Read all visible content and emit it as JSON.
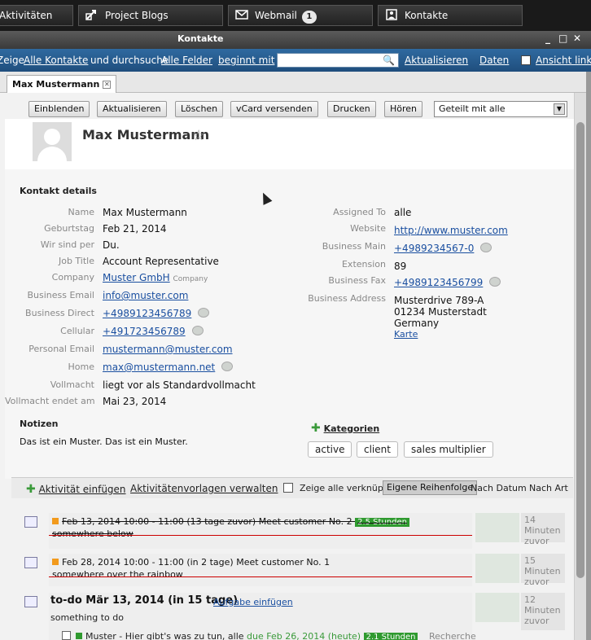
{
  "taskbar": {
    "tasks": [
      {
        "label": "Aktivitäten",
        "icon": "list-icon"
      },
      {
        "label": "Project Blogs",
        "icon": "blog-icon"
      },
      {
        "label": "Webmail",
        "icon": "mail-icon",
        "badge": "1"
      },
      {
        "label": "Kontakte",
        "icon": "contacts-icon"
      }
    ]
  },
  "window": {
    "title": "Kontakte",
    "minimize": "_",
    "maximize": "□",
    "close": "✕"
  },
  "search": {
    "prefix": "Zeige",
    "scope": "Alle Kontakte",
    "mid": "und durchsuche",
    "field": "Alle Felder",
    "mode": "beginnt mit",
    "value": "",
    "refresh": "Aktualisieren",
    "data": "Daten",
    "view": "Ansicht links"
  },
  "tab": {
    "label": "Max Mustermann"
  },
  "toolbar": {
    "buttons": [
      "Einblenden",
      "Aktualisieren",
      "Löschen",
      "vCard versenden",
      "Drucken",
      "Hören"
    ],
    "share": "Geteilt mit alle"
  },
  "contact": {
    "name": "Max Mustermann",
    "section_title": "Kontakt details",
    "left": [
      {
        "label": "Name",
        "value": "Max Mustermann"
      },
      {
        "label": "Geburtstag",
        "value": "Feb 21, 2014"
      },
      {
        "label": "Wir sind per",
        "value": "Du."
      },
      {
        "label": "Job Title",
        "value": "Account Representative"
      },
      {
        "label": "Company",
        "value": "Muster GmbH",
        "note": "Company"
      },
      {
        "label": "Business Email",
        "value": "info@muster.com"
      },
      {
        "label": "Business Direct",
        "value": "+4989123456789"
      },
      {
        "label": "Cellular",
        "value": "+491723456789"
      },
      {
        "label": "Personal Email",
        "value": "mustermann@muster.com"
      },
      {
        "label": "Home",
        "value": "max@mustermann.net"
      },
      {
        "label": "Vollmacht",
        "value": "liegt vor als Standardvollmacht"
      },
      {
        "label": "Vollmacht endet am",
        "value": "Mai 23, 2014"
      }
    ],
    "right": [
      {
        "label": "Assigned To",
        "value": "alle"
      },
      {
        "label": "Website",
        "value": "http://www.muster.com"
      },
      {
        "label": "Business Main",
        "value": "+4989234567-0"
      },
      {
        "label": "Extension",
        "value": "89"
      },
      {
        "label": "Business Fax",
        "value": "+4989123456799"
      },
      {
        "label": "Business Address",
        "line1": "Musterdrive 789-A",
        "line2": "01234 Musterstadt",
        "line3": "Germany",
        "map": "Karte"
      }
    ],
    "notes_title": "Notizen",
    "notes": "Das ist ein Muster. Das ist ein Muster.",
    "categories_title": "Kategorien",
    "categories": [
      "active",
      "client",
      "sales multiplier"
    ]
  },
  "activities": {
    "add": "Aktivität einfügen",
    "manage": "Aktivitätenvorlagen verwalten",
    "show_linked": "Zeige alle verknüpften",
    "sort_own": "Eigene Reihenfolge",
    "sort_date": "Nach Datum",
    "sort_type": "Nach Art",
    "items": [
      {
        "title": "Feb 13, 2014 10:00 - 11:00 (13 tage zuvor) Meet customer No. 2",
        "duration": "2.5 Stunden",
        "desc": "somewhere below",
        "ago": "14 Minuten zuvor"
      },
      {
        "title": "Feb 28, 2014 10:00 - 11:00 (in 2 tage) Meet customer No. 1",
        "desc": "somewhere over the rainbow",
        "ago": "15 Minuten zuvor"
      }
    ],
    "todo": {
      "title": "to-do Mär 13, 2014 (in 15 tage)",
      "add_task": "Aufgabe einfügen",
      "desc": "something to do",
      "ago": "12 Minuten zuvor",
      "task_text": "Muster - Hier gibt's was zu tun, alle",
      "task_due": "due Feb 26, 2014 (heute)",
      "task_duration": "2.1 Stunden",
      "task_extra": "Recherche"
    }
  }
}
